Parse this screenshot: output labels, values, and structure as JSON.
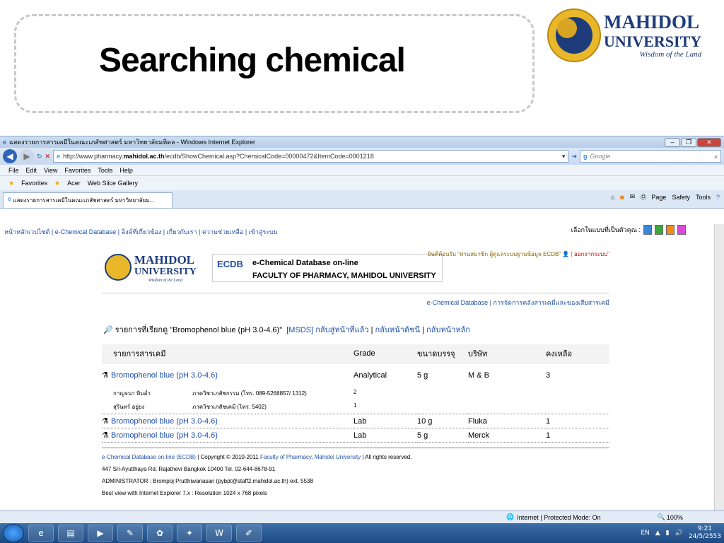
{
  "slide": {
    "title": "Searching chemical",
    "logo_line1": "MAHIDOL",
    "logo_line2": "UNIVERSITY",
    "logo_tagline": "Wisdom of the Land"
  },
  "browser": {
    "window_title": "แสดงรายการสารเคมีในคณะเภสัชศาสตร์ มหาวิทยาลัยมหิดล - Windows Internet Explorer",
    "url_prefix": "http://www.pharmacy.",
    "url_domain": "mahidol.ac.th",
    "url_rest": "/ecdb/ShowChemical.asp?ChemicalCode=00000472&ItemCode=0001218",
    "search_placeholder": "Google",
    "menu": [
      "File",
      "Edit",
      "View",
      "Favorites",
      "Tools",
      "Help"
    ],
    "fav_label": "Favorites",
    "fav_acer": "Acer",
    "fav_webslice": "Web Slice Gallery",
    "tab_title": "แสดงรายการสารเคมีในคณะเภสัชศาสตร์ มหาวิทยาลัยม...",
    "cmd_page": "Page",
    "cmd_safety": "Safety",
    "cmd_tools": "Tools",
    "status_zone": "Internet | Protected Mode: On",
    "zoom": "100%"
  },
  "page": {
    "top_nav": "หน้าหลักเวปไซต์ | e-Chemical Database | ลิงค์ที่เกี่ยวข้อง | เกี่ยวกับเรา | ความช่วยเหลือ | เข้าสู่ระบบ",
    "theme_label": "เลือกในแบบที่เป็นตัวคุณ :",
    "theme_colors": [
      "#3a86d9",
      "#3aa83a",
      "#f08a1a",
      "#d94ad9"
    ],
    "small_logo_line1": "MAHIDOL",
    "small_logo_line2": "UNIVERSITY",
    "small_logo_tagline": "Wisdom of the Land",
    "ecdb_icon": "ECDB",
    "ecdb_title": "e-Chemical Database on-line",
    "ecdb_faculty": "FACULTY OF PHARMACY, MAHIDOL UNIVERSITY",
    "welcome_text": "ยินดีต้อนรับ \"ท่านสมาชิก ผู้ดูแลระบบฐานข้อมูล ECDB\"",
    "logout": "ออกจากระบบ\"",
    "sub_nav": "e-Chemical Database |  การจัดการคลังสารเคมีและของเสียสารเคมี",
    "query_text": "รายการที่เรียกดู \"Bromophenol blue (pH 3.0-4.6)\"",
    "query_msds": "[MSDS]",
    "query_back": "กลับสู่หน้าที่แล้ว",
    "query_index": "กลับหน้าดัชนี",
    "query_home": "กลับหน้าหลัก",
    "headers": [
      "รายการสารเคมี",
      "Grade",
      "ขนาดบรรจุ",
      "บริษัท",
      "คงเหลือ"
    ],
    "rows": [
      {
        "name": "Bromophenol blue (pH 3.0-4.6)",
        "grade": "Analytical",
        "size": "5 g",
        "company": "M & B",
        "remain": "3"
      },
      {
        "name": "Bromophenol blue (pH 3.0-4.6)",
        "grade": "Lab",
        "size": "10 g",
        "company": "Fluka",
        "remain": "1"
      },
      {
        "name": "Bromophenol blue (pH 3.0-4.6)",
        "grade": "Lab",
        "size": "5 g",
        "company": "Merck",
        "remain": "1"
      }
    ],
    "holders": [
      {
        "person": "กาญจนา ทิมอ่ำ",
        "dept": "ภาควิชาเภสัชกรรม (โทร. 089-5268857/ 1312)",
        "qty": "2"
      },
      {
        "person": "สุรินทร์ อยู่ยง",
        "dept": "ภาควิชาเภสัชเคมี (โทร. 5402)",
        "qty": "1"
      }
    ],
    "footer_line1_link": "e-Chemical Database on-line (ECDB)",
    "footer_line1_copy": "| Copyright © 2010-2011",
    "footer_line1_fac": "Faculty of Pharmacy, Mahidol University",
    "footer_line1_rights": "| All rights reserved.",
    "footer_line2": "447 Sri-Ayutthaya Rd. Rajathevi Bangkok 10400 Tel. 02-644-8678-91",
    "footer_line3": "ADMINISTRATOR : Brompoj Prutthiwanasan (pybpt@staff2.mahidol.ac.th) ext. 5538",
    "footer_line4": "Best view with Internet Explorer 7.x : Resolution 1024 x 768 pixels"
  },
  "taskbar": {
    "lang": "EN",
    "time": "9:21",
    "date": "24/5/2553"
  }
}
